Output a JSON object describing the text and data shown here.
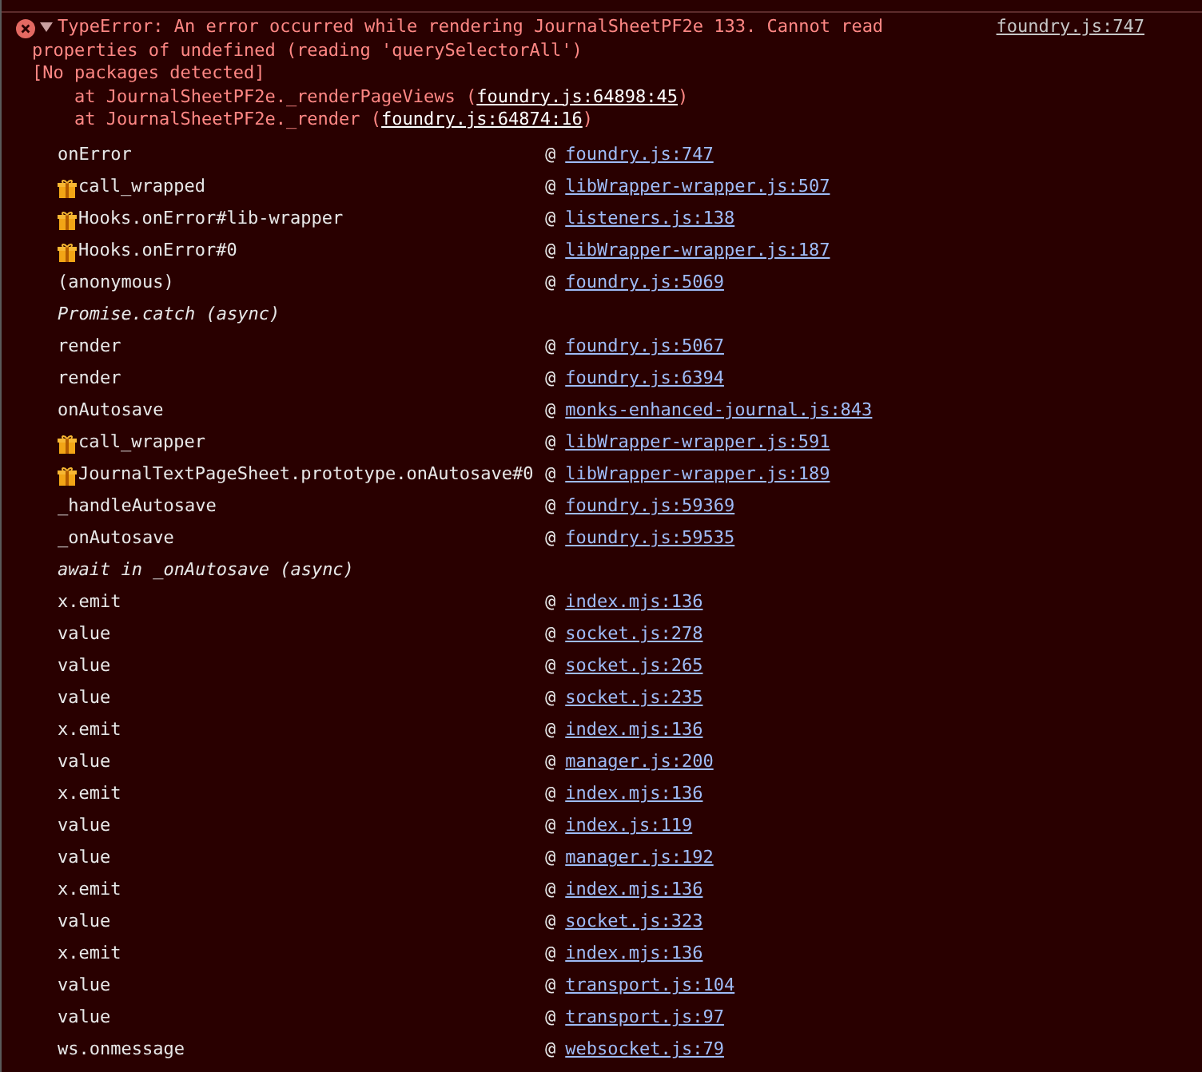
{
  "error": {
    "expanded": true,
    "message_lines": [
      "TypeError: An error occurred while rendering JournalSheetPF2e 133. Cannot read",
      "properties of undefined (reading 'querySelectorAll')",
      "[No packages detected]"
    ],
    "source": "foundry.js:747",
    "stack": [
      {
        "prefix": "    at JournalSheetPF2e._renderPageViews (",
        "link": "foundry.js:64898:45",
        "suffix": ")"
      },
      {
        "prefix": "    at JournalSheetPF2e._render (",
        "link": "foundry.js:64874:16",
        "suffix": ")"
      }
    ]
  },
  "frames": [
    {
      "kind": "frame",
      "name": "onError",
      "at": "@",
      "location": "foundry.js:747"
    },
    {
      "kind": "wrapped",
      "name": "call_wrapped",
      "at": "@",
      "location": "libWrapper-wrapper.js:507"
    },
    {
      "kind": "wrapped",
      "name": "Hooks.onError#lib-wrapper",
      "at": "@",
      "location": "listeners.js:138"
    },
    {
      "kind": "wrapped",
      "name": "Hooks.onError#0",
      "at": "@",
      "location": "libWrapper-wrapper.js:187"
    },
    {
      "kind": "frame",
      "name": "(anonymous)",
      "at": "@",
      "location": "foundry.js:5069"
    },
    {
      "kind": "async",
      "name": "Promise.catch (async)"
    },
    {
      "kind": "frame",
      "name": "render",
      "at": "@",
      "location": "foundry.js:5067"
    },
    {
      "kind": "frame",
      "name": "render",
      "at": "@",
      "location": "foundry.js:6394"
    },
    {
      "kind": "frame",
      "name": "onAutosave",
      "at": "@",
      "location": "monks-enhanced-journal.js:843"
    },
    {
      "kind": "wrapped",
      "name": "call_wrapper",
      "at": "@",
      "location": "libWrapper-wrapper.js:591"
    },
    {
      "kind": "wrapped",
      "name": "JournalTextPageSheet.prototype.onAutosave#0",
      "at": "@",
      "location": "libWrapper-wrapper.js:189"
    },
    {
      "kind": "frame",
      "name": "_handleAutosave",
      "at": "@",
      "location": "foundry.js:59369"
    },
    {
      "kind": "frame",
      "name": "_onAutosave",
      "at": "@",
      "location": "foundry.js:59535"
    },
    {
      "kind": "async",
      "name": "await in _onAutosave (async)"
    },
    {
      "kind": "frame",
      "name": "x.emit",
      "at": "@",
      "location": "index.mjs:136"
    },
    {
      "kind": "frame",
      "name": "value",
      "at": "@",
      "location": "socket.js:278"
    },
    {
      "kind": "frame",
      "name": "value",
      "at": "@",
      "location": "socket.js:265"
    },
    {
      "kind": "frame",
      "name": "value",
      "at": "@",
      "location": "socket.js:235"
    },
    {
      "kind": "frame",
      "name": "x.emit",
      "at": "@",
      "location": "index.mjs:136"
    },
    {
      "kind": "frame",
      "name": "value",
      "at": "@",
      "location": "manager.js:200"
    },
    {
      "kind": "frame",
      "name": "x.emit",
      "at": "@",
      "location": "index.mjs:136"
    },
    {
      "kind": "frame",
      "name": "value",
      "at": "@",
      "location": "index.js:119"
    },
    {
      "kind": "frame",
      "name": "value",
      "at": "@",
      "location": "manager.js:192"
    },
    {
      "kind": "frame",
      "name": "x.emit",
      "at": "@",
      "location": "index.mjs:136"
    },
    {
      "kind": "frame",
      "name": "value",
      "at": "@",
      "location": "socket.js:323"
    },
    {
      "kind": "frame",
      "name": "x.emit",
      "at": "@",
      "location": "index.mjs:136"
    },
    {
      "kind": "frame",
      "name": "value",
      "at": "@",
      "location": "transport.js:104"
    },
    {
      "kind": "frame",
      "name": "value",
      "at": "@",
      "location": "transport.js:97"
    },
    {
      "kind": "frame",
      "name": "ws.onmessage",
      "at": "@",
      "location": "websocket.js:79"
    }
  ]
}
